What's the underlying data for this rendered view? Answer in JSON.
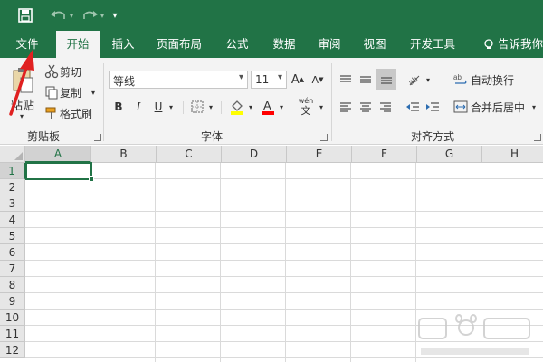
{
  "title_bar": {
    "qat": [
      "save-icon",
      "undo-icon",
      "redo-icon",
      "customize-icon"
    ]
  },
  "tabs": [
    {
      "label": "文件"
    },
    {
      "label": "开始",
      "active": true
    },
    {
      "label": "插入"
    },
    {
      "label": "页面布局"
    },
    {
      "label": "公式"
    },
    {
      "label": "数据"
    },
    {
      "label": "审阅"
    },
    {
      "label": "视图"
    },
    {
      "label": "开发工具"
    }
  ],
  "tell_me": "告诉我你",
  "clipboard": {
    "paste": "粘贴",
    "cut": "剪切",
    "copy": "复制",
    "format_painter": "格式刷",
    "group_label": "剪贴板"
  },
  "font": {
    "font_name": "等线",
    "font_size": "11",
    "group_label": "字体",
    "bold": "B",
    "italic": "I",
    "underline": "U",
    "wen_top": "wén",
    "wen_bottom": "文"
  },
  "alignment": {
    "wrap_text": "自动换行",
    "merge_center": "合并后居中",
    "group_label": "对齐方式"
  },
  "columns": [
    "A",
    "B",
    "C",
    "D",
    "E",
    "F",
    "G",
    "H"
  ],
  "rows": [
    "1",
    "2",
    "3",
    "4",
    "5",
    "6",
    "7",
    "8",
    "9",
    "10",
    "11",
    "12"
  ],
  "active_cell": "A1",
  "colors": {
    "brand": "#217346",
    "highlight": "#ffff00",
    "font_color": "#ff0000",
    "annotation": "#e02020"
  }
}
